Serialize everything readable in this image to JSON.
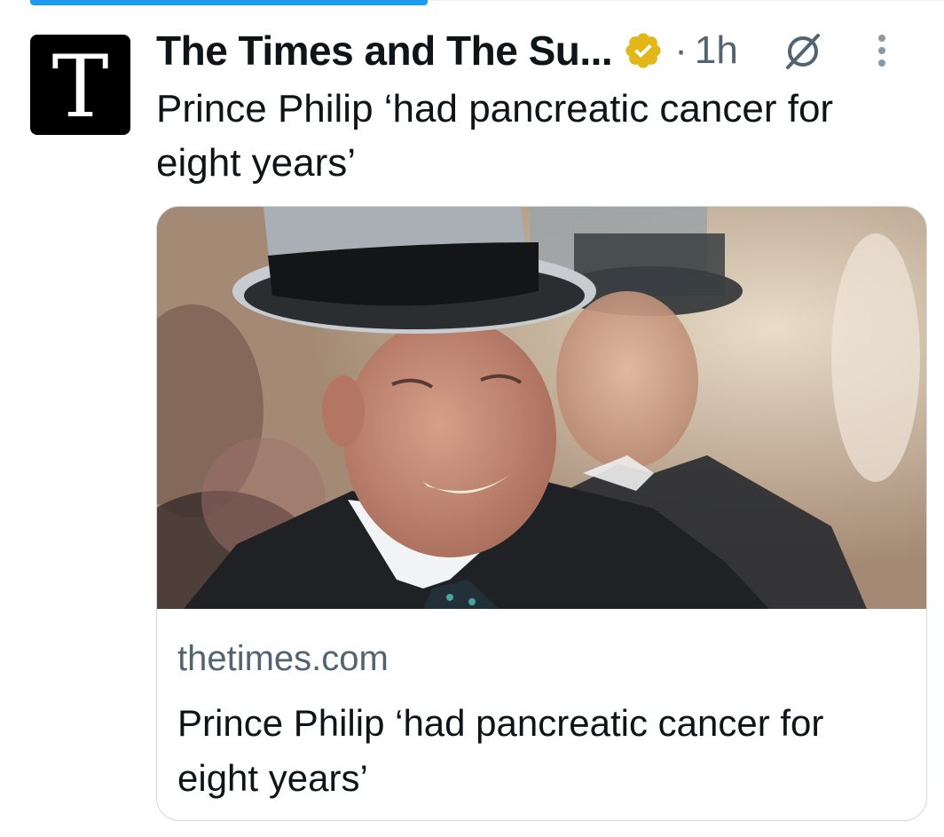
{
  "tweet": {
    "author_name": "The Times and The Su...",
    "author_avatar_letter": "T",
    "verified_badge_color": "#e2b719",
    "separator": "·",
    "timestamp": "1h",
    "text": "Prince Philip ‘had pancreatic cancer for eight years’"
  },
  "link_card": {
    "domain": "thetimes.com",
    "title": "Prince Philip ‘had pancreatic cancer for eight years’"
  },
  "icons": {
    "verified": "verified-badge-icon",
    "grok": "grok-icon",
    "more": "more-options-icon"
  },
  "colors": {
    "accent": "#1d9bf0",
    "secondary_text": "#536471",
    "primary_text": "#0f1419",
    "card_border": "#cfd9de"
  }
}
